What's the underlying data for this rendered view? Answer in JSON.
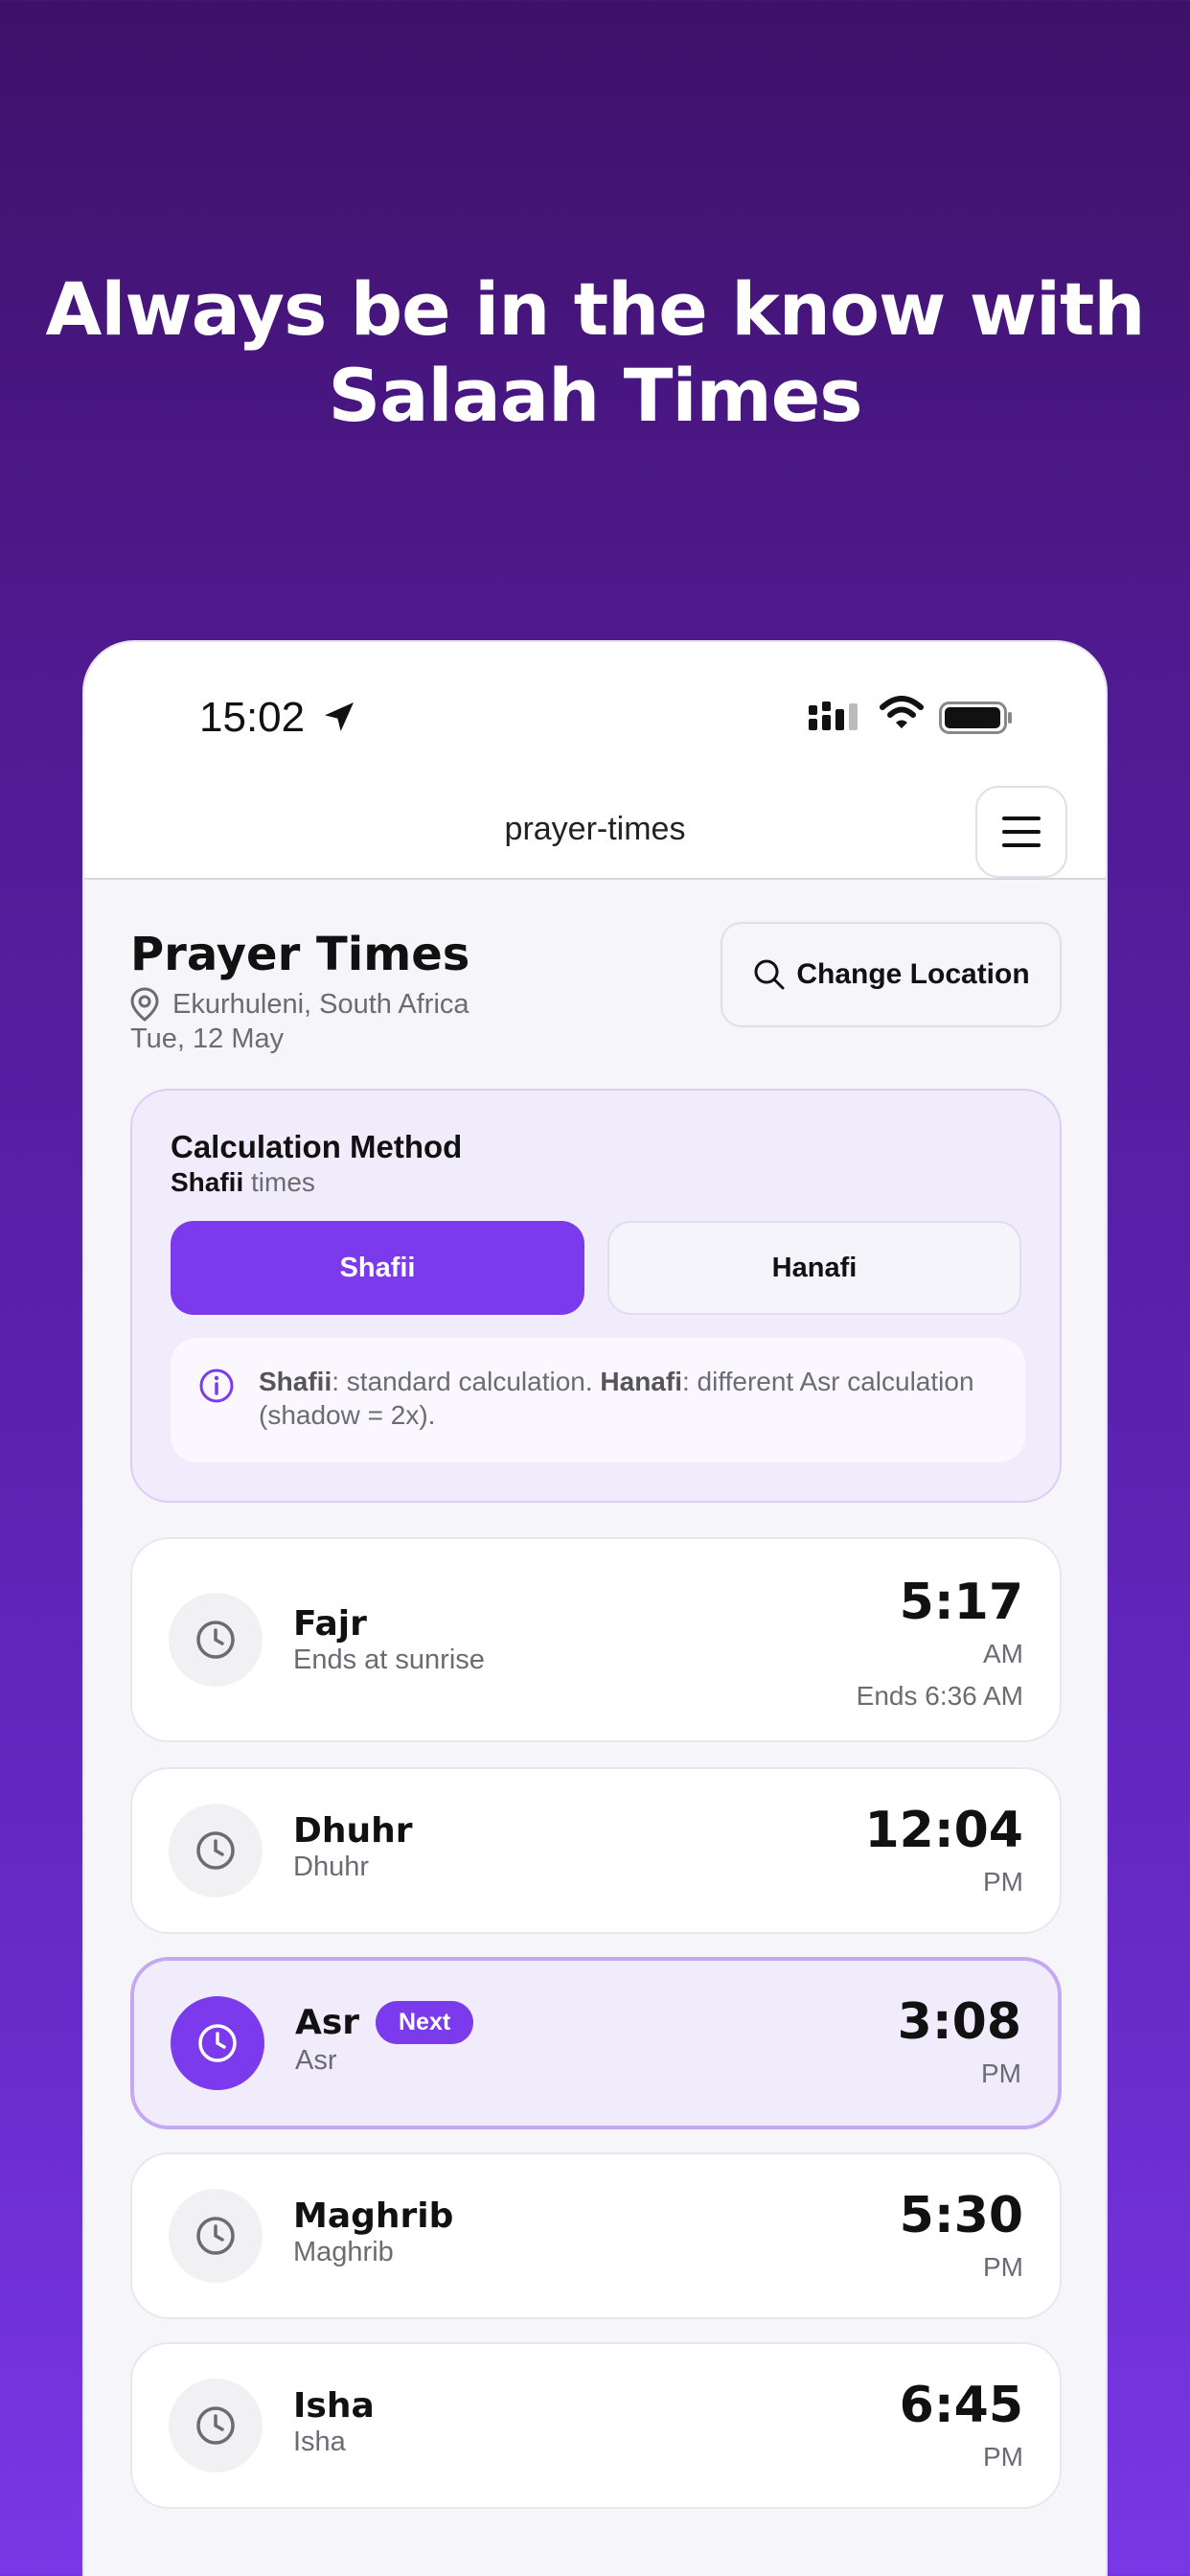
{
  "headline": {
    "line1": "Always be in the know with",
    "line2": "Salaah Times"
  },
  "statusbar": {
    "time": "15:02"
  },
  "navbar": {
    "title": "prayer-times"
  },
  "header": {
    "title": "Prayer Times",
    "location": "Ekurhuleni, South Africa",
    "date": "Tue, 12 May",
    "change_location_label": "Change Location"
  },
  "calculation": {
    "title": "Calculation Method",
    "selected_bold": "Shafii",
    "selected_suffix": "times",
    "options": [
      {
        "label": "Shafii",
        "active": true
      },
      {
        "label": "Hanafi",
        "active": false
      }
    ],
    "info": {
      "term1": "Shafii",
      "text1": ": standard calculation. ",
      "term2": "Hanafi",
      "text2": ": different Asr calculation (shadow = 2x)."
    }
  },
  "prayers": [
    {
      "name": "Fajr",
      "subtitle": "Ends at sunrise",
      "time": "5:17",
      "ampm": "AM",
      "ends": "Ends 6:36 AM",
      "next": false
    },
    {
      "name": "Dhuhr",
      "subtitle": "Dhuhr",
      "time": "12:04",
      "ampm": "PM",
      "next": false
    },
    {
      "name": "Asr",
      "subtitle": "Asr",
      "time": "3:08",
      "ampm": "PM",
      "next": true,
      "badge": "Next"
    },
    {
      "name": "Maghrib",
      "subtitle": "Maghrib",
      "time": "5:30",
      "ampm": "PM",
      "next": false
    },
    {
      "name": "Isha",
      "subtitle": "Isha",
      "time": "6:45",
      "ampm": "PM",
      "next": false
    }
  ],
  "colors": {
    "accent": "#7c3aed",
    "accent_light": "#f1ecfb"
  }
}
